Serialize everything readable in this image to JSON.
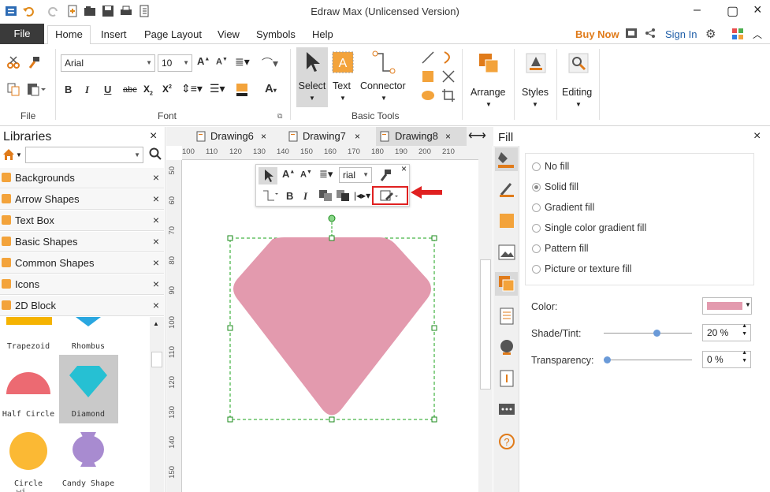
{
  "window": {
    "title": "Edraw Max (Unlicensed Version)"
  },
  "menu": {
    "file": "File",
    "tabs": [
      "Home",
      "Insert",
      "Page Layout",
      "View",
      "Symbols",
      "Help"
    ],
    "buy_now": "Buy Now",
    "sign_in": "Sign In"
  },
  "ribbon": {
    "groups": {
      "file": "File",
      "font": "Font",
      "basic_tools": "Basic Tools"
    },
    "font_name": "Arial",
    "font_size": "10",
    "select_label": "Select",
    "text_label": "Text",
    "connector_label": "Connector",
    "arrange_label": "Arrange",
    "styles_label": "Styles",
    "editing_label": "Editing"
  },
  "libraries": {
    "title": "Libraries",
    "search_placeholder": "",
    "items": [
      "Backgrounds",
      "Arrow Shapes",
      "Text Box",
      "Basic Shapes",
      "Common Shapes",
      "Icons",
      "2D Block"
    ],
    "shapes": [
      "Trapezoid",
      "Rhombus",
      "Half Circle",
      "Diamond",
      "Circle wi...",
      "Candy Shape"
    ]
  },
  "document_tabs": [
    "Drawing6",
    "Drawing7",
    "Drawing8"
  ],
  "ruler": {
    "h": [
      "100",
      "110",
      "120",
      "130",
      "140",
      "150",
      "160",
      "170",
      "180",
      "190",
      "200",
      "210"
    ],
    "v": [
      "50",
      "60",
      "70",
      "80",
      "90",
      "100",
      "110",
      "120",
      "130",
      "140",
      "150"
    ]
  },
  "floating_toolbar": {
    "font": "rial"
  },
  "fill_panel": {
    "title": "Fill",
    "options": [
      "No fill",
      "Solid fill",
      "Gradient fill",
      "Single color gradient fill",
      "Pattern fill",
      "Picture or texture fill"
    ],
    "selected": "Solid fill",
    "color_label": "Color:",
    "color_value": "#e39aae",
    "shade_label": "Shade/Tint:",
    "shade_value": "20 %",
    "shade_fraction": 0.6,
    "transparency_label": "Transparency:",
    "transparency_value": "0 %",
    "transparency_fraction": 0
  },
  "colors": {
    "accent_orange": "#e07b1a",
    "shape_fill": "#e39aae",
    "highlight_red": "#e02020"
  }
}
